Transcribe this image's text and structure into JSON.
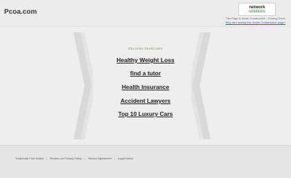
{
  "header": {
    "site_title": "Pcoa.com",
    "logo_line1": "network",
    "logo_line2": "solutions",
    "uc_note": "This Page is Under Construction - Coming Soon!",
    "uc_link": "Why am I seeing this 'Under Construction' page?"
  },
  "main": {
    "related_label": "RELATED SEARCHES",
    "links": [
      "Healthy Weight Loss",
      "find a tutor",
      "Health Insurance",
      "Accident Lawyers",
      "Top 10 Luxury Cars"
    ]
  },
  "footer": {
    "links": [
      "Trademark Free Notice",
      "Review our Privacy Policy",
      "Service Agreement",
      "Legal Notice"
    ]
  },
  "colors": {
    "accent": "#7aa12a",
    "brand": "#1f7a2f"
  }
}
